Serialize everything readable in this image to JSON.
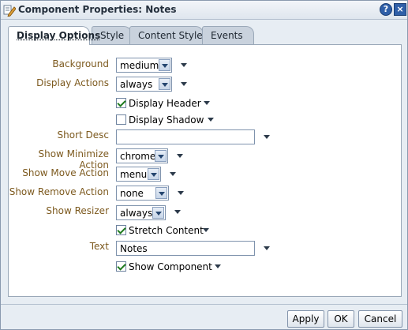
{
  "window": {
    "title": "Component Properties: Notes",
    "help_label": "?",
    "close_label": "×"
  },
  "tabs": [
    {
      "label": "Display Options",
      "active": true
    },
    {
      "label": "Style",
      "active": false
    },
    {
      "label": "Content Style",
      "active": false
    },
    {
      "label": "Events",
      "active": false
    }
  ],
  "form": {
    "background": {
      "label": "Background",
      "value": "medium"
    },
    "display_actions": {
      "label": "Display Actions",
      "value": "always"
    },
    "display_header": {
      "label": "Display Header",
      "checked": true
    },
    "display_shadow": {
      "label": "Display Shadow",
      "checked": false
    },
    "short_desc": {
      "label": "Short Desc",
      "value": ""
    },
    "show_minimize_action": {
      "label": "Show Minimize Action",
      "value": "chrome"
    },
    "show_move_action": {
      "label": "Show Move Action",
      "value": "menu"
    },
    "show_remove_action": {
      "label": "Show Remove Action",
      "value": "none"
    },
    "show_resizer": {
      "label": "Show Resizer",
      "value": "always"
    },
    "stretch_content": {
      "label": "Stretch Content",
      "checked": true
    },
    "text": {
      "label": "Text",
      "value": "Notes"
    },
    "show_component": {
      "label": "Show Component",
      "checked": true
    }
  },
  "buttons": {
    "apply": "Apply",
    "ok": "OK",
    "cancel": "Cancel"
  },
  "colors": {
    "label_color": "#7d5a1f",
    "accent": "#2f5fa8"
  }
}
